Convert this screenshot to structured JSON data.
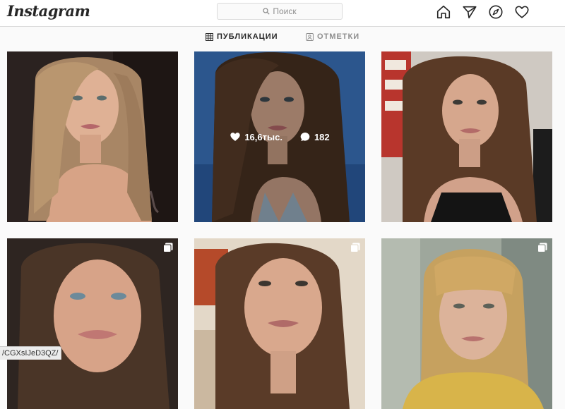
{
  "app": {
    "logo_text": "Instagram"
  },
  "search": {
    "placeholder": "Поиск",
    "icon": "search-icon"
  },
  "nav": {
    "icons": [
      "home-icon",
      "direct-icon",
      "explore-icon",
      "activity-heart-icon"
    ]
  },
  "tabs": [
    {
      "label": "ПУБЛИКАЦИИ",
      "icon": "grid-icon",
      "active": true
    },
    {
      "label": "ОТМЕТКИ",
      "icon": "tagged-icon",
      "active": false
    }
  ],
  "posts": [
    {
      "id": "post-1",
      "multi": false
    },
    {
      "id": "post-2",
      "multi": false,
      "hover": true,
      "likes": "16,6тыс.",
      "comments": "182"
    },
    {
      "id": "post-3",
      "multi": false
    },
    {
      "id": "post-4",
      "multi": true
    },
    {
      "id": "post-5",
      "multi": true
    },
    {
      "id": "post-6",
      "multi": true
    }
  ],
  "status_bar": {
    "url": "/CGXsIJeD3QZ/"
  },
  "colors": {
    "border": "#dbdbdb",
    "background": "#fafafa",
    "muted": "#8e8e8e",
    "text": "#262626"
  }
}
